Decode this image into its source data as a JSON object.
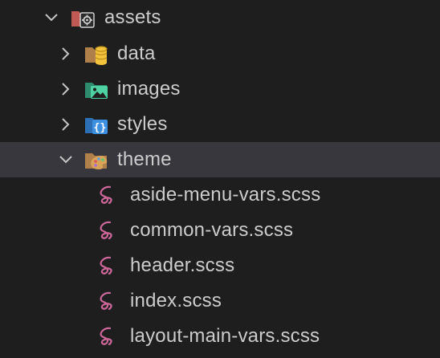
{
  "explorer": {
    "folders": [
      {
        "name": "assets",
        "expanded": true,
        "icon": "folder-config-icon"
      },
      {
        "name": "data",
        "expanded": false,
        "icon": "folder-database-icon"
      },
      {
        "name": "images",
        "expanded": false,
        "icon": "folder-images-icon"
      },
      {
        "name": "styles",
        "expanded": false,
        "icon": "folder-css-icon"
      },
      {
        "name": "theme",
        "expanded": true,
        "selected": true,
        "icon": "folder-theme-icon"
      }
    ],
    "theme_files": [
      {
        "name": "aside-menu-vars.scss",
        "icon": "sass-icon"
      },
      {
        "name": "common-vars.scss",
        "icon": "sass-icon"
      },
      {
        "name": "header.scss",
        "icon": "sass-icon"
      },
      {
        "name": "index.scss",
        "icon": "sass-icon"
      },
      {
        "name": "layout-main-vars.scss",
        "icon": "sass-icon"
      }
    ]
  },
  "colors": {
    "background": "#1e1e1e",
    "selected_row": "#37373d",
    "text": "#cccccc",
    "sass_pink": "#cd6799"
  }
}
